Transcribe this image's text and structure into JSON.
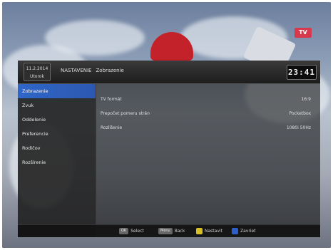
{
  "header": {
    "date": "11.2.2014",
    "weekday": "Utorok",
    "breadcrumb_section": "NASTAVENIE",
    "breadcrumb_page": "Zobrazenie",
    "clock": "23:41"
  },
  "channel_logo": "TV",
  "sidebar": {
    "items": [
      {
        "label": "Zobrazenie"
      },
      {
        "label": "Zvuk"
      },
      {
        "label": "Oddelenie"
      },
      {
        "label": "Preferencie"
      },
      {
        "label": "Rodičov"
      },
      {
        "label": "Rozšírenie"
      }
    ]
  },
  "settings": [
    {
      "label": "TV formát",
      "value": "16:9"
    },
    {
      "label": "Prepočet pomeru strán",
      "value": "Pocketbox"
    },
    {
      "label": "Rozlíšenie",
      "value": "1080i 50Hz"
    }
  ],
  "footer": {
    "ok_key": "OK",
    "ok_label": "Select",
    "menu_key": "Menu",
    "menu_label": "Back",
    "yellow_label": "Nastavit",
    "blue_label": "Zavriet"
  },
  "colors": {
    "accent": "#2f66c8",
    "yellow_key": "#d6c024",
    "blue_key": "#2e5fc8",
    "logo": "#d8384c"
  }
}
